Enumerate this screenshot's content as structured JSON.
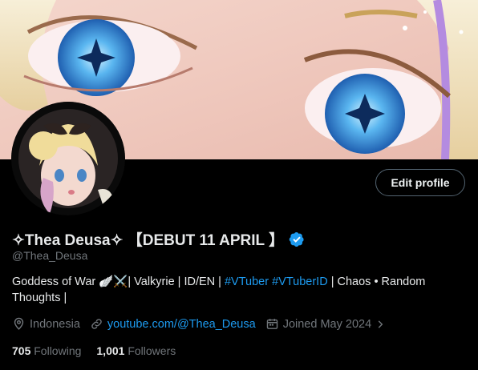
{
  "profile": {
    "name": "✧Thea Deusa✧ 【DEBUT 11 APRIL 】",
    "handle": "@Thea_Deusa",
    "verified": true,
    "edit_label": "Edit profile",
    "bio": {
      "part1": "Goddess of War 🪽⚔️| Valkyrie | ID/EN | ",
      "tag1": "#VTuber",
      "space": " ",
      "tag2": "#VTuberID",
      "part2": " | Chaos • Random Thoughts |"
    },
    "location": "Indonesia",
    "website": "youtube.com/@Thea_Deusa",
    "joined": "Joined May 2024",
    "following_count": "705",
    "following_label": "Following",
    "followers_count": "1,001",
    "followers_label": "Followers"
  },
  "icons": {
    "verified": "verified-badge-icon",
    "location": "location-pin-icon",
    "link": "link-icon",
    "calendar": "calendar-icon",
    "chevron": "chevron-right-icon"
  },
  "colors": {
    "accent": "#1d9bf0",
    "muted": "#71767b",
    "text": "#e7e9ea",
    "background": "#000000"
  }
}
